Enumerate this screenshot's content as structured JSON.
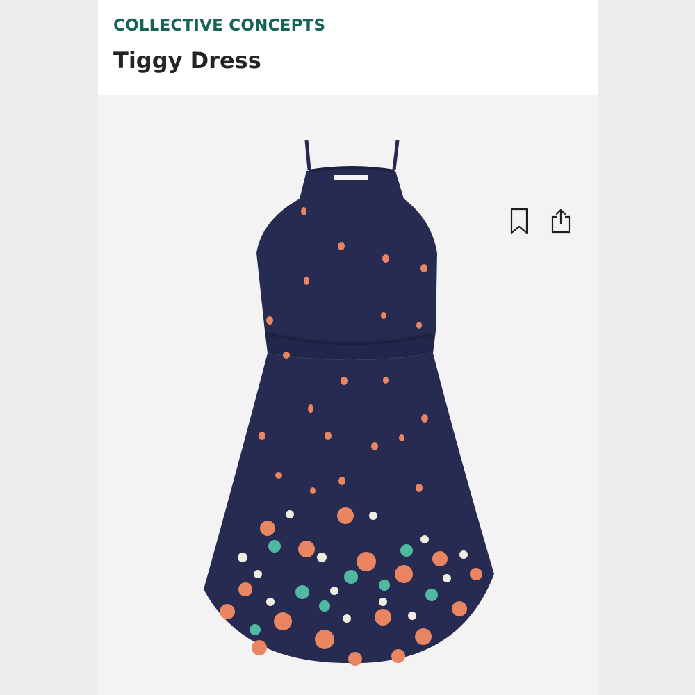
{
  "product": {
    "brand": "COLLECTIVE CONCEPTS",
    "name": "Tiggy Dress"
  },
  "actions": {
    "bookmark_icon": "bookmark-icon",
    "share_icon": "share-icon"
  },
  "colors": {
    "brand": "#176356",
    "dress_navy": "#262a4f",
    "flower_orange": "#e98561",
    "flower_teal": "#4fb9a1",
    "flower_cream": "#f1ece2"
  }
}
